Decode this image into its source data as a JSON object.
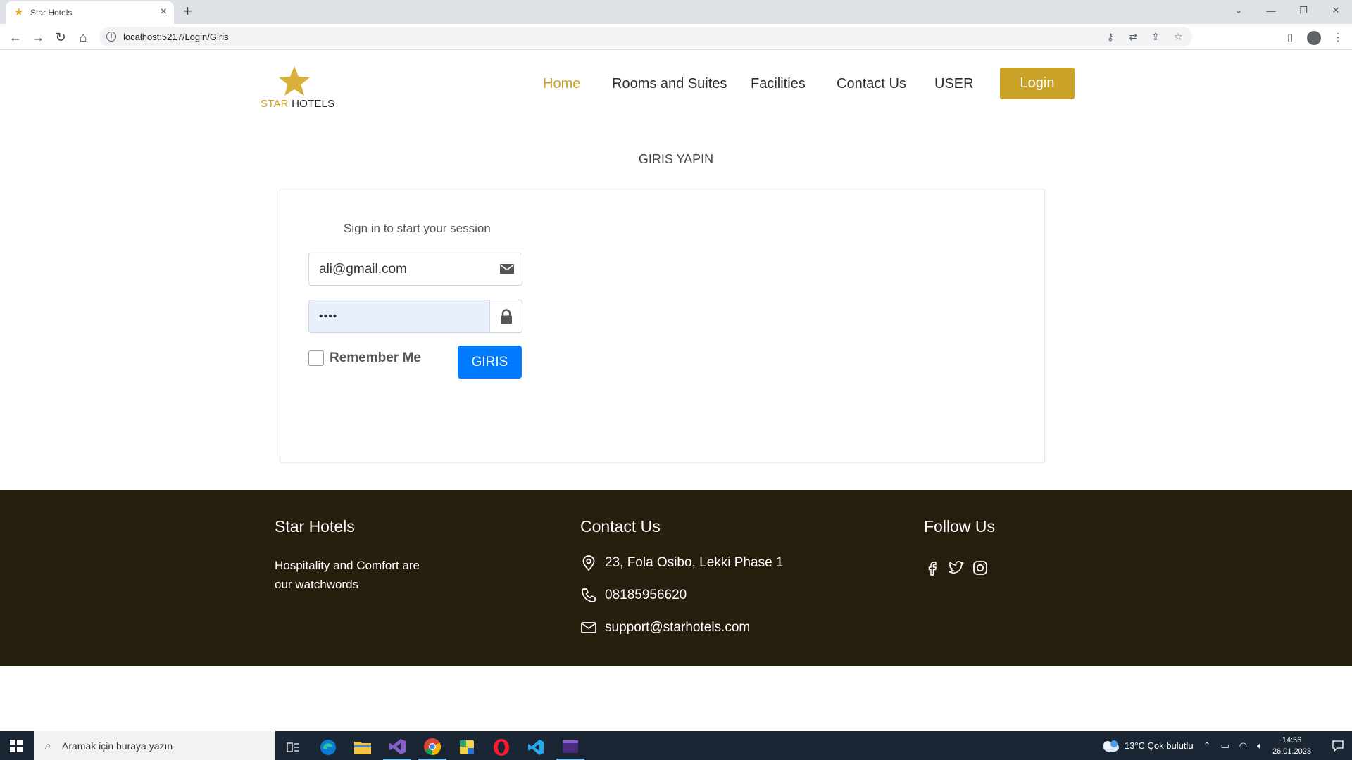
{
  "browser": {
    "tab_title": "Star Hotels",
    "url": "localhost:5217/Login/Giris"
  },
  "header": {
    "logo_part1": "STAR",
    "logo_part2": "HOTELS",
    "nav": [
      {
        "label": "Home",
        "active": true
      },
      {
        "label": "Rooms and Suites",
        "active": false
      },
      {
        "label": "Facilities",
        "active": false
      },
      {
        "label": "Contact Us",
        "active": false
      },
      {
        "label": "USER",
        "active": false
      }
    ],
    "login_label": "Login"
  },
  "main": {
    "heading": "GIRIS YAPIN",
    "subtitle": "Sign in to start your session",
    "email_value": "ali@gmail.com",
    "password_value": "••••",
    "remember_label": "Remember Me",
    "submit_label": "GIRIS"
  },
  "footer": {
    "brand_heading": "Star Hotels",
    "tagline_line1": "Hospitality and Comfort are",
    "tagline_line2": "our watchwords",
    "contact_heading": "Contact Us",
    "address": "23, Fola Osibo, Lekki Phase 1",
    "phone": "08185956620",
    "email": "support@starhotels.com",
    "follow_heading": "Follow Us"
  },
  "taskbar": {
    "search_placeholder": "Aramak için buraya yazın",
    "weather": "13°C  Çok bulutlu",
    "time": "14:56",
    "date": "26.01.2023"
  },
  "colors": {
    "accent": "#c9a227",
    "primary_button": "#007bff",
    "footer_bg": "#261f0e",
    "taskbar_bg": "#1b2635"
  }
}
